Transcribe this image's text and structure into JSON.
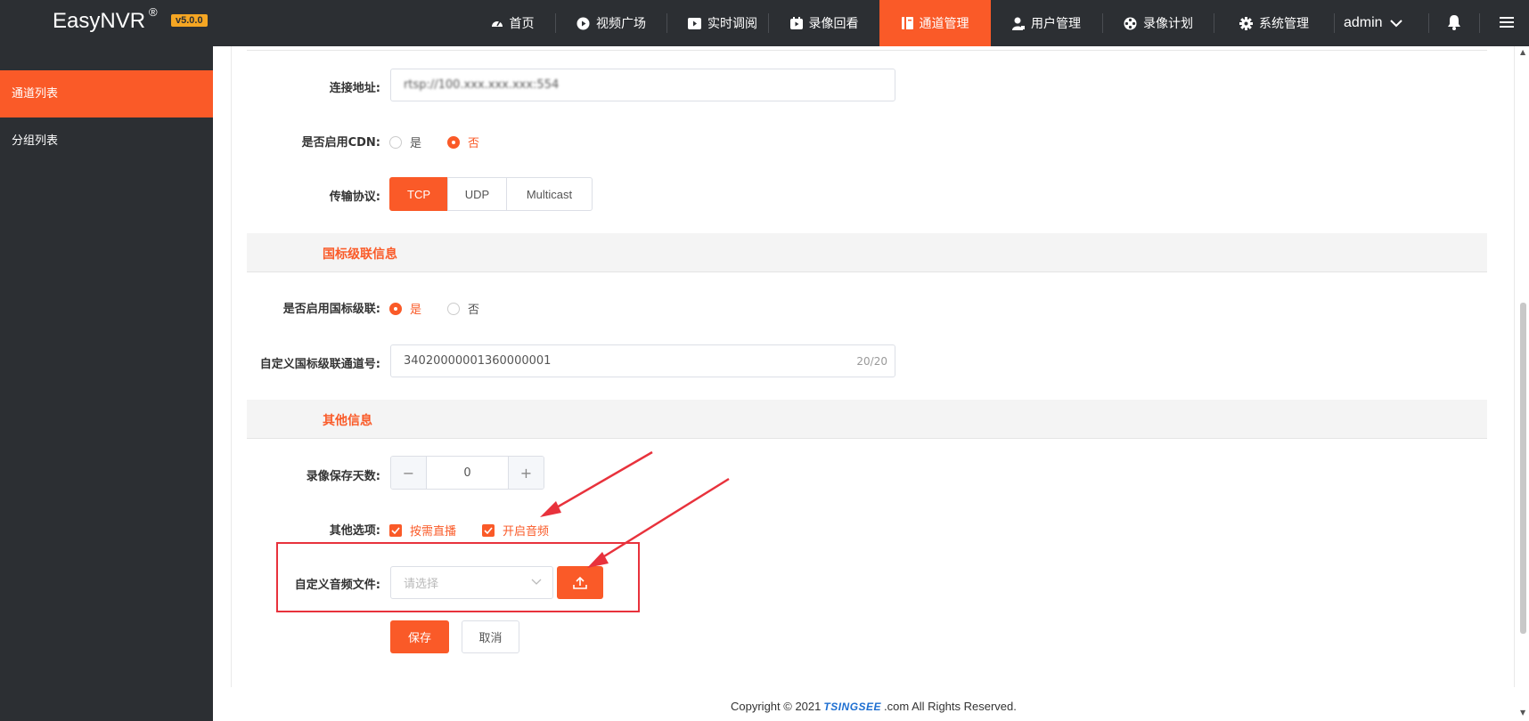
{
  "header": {
    "logo": "EasyNVR",
    "logo_mark": "®",
    "version": "v5.0.0",
    "nav": [
      {
        "label": "首页",
        "icon": "dashboard-icon"
      },
      {
        "label": "视频广场",
        "icon": "play-circle-icon"
      },
      {
        "label": "实时调阅",
        "icon": "video-icon"
      },
      {
        "label": "录像回看",
        "icon": "playback-icon"
      },
      {
        "label": "通道管理",
        "icon": "book-icon",
        "active": true
      },
      {
        "label": "用户管理",
        "icon": "user-icon"
      },
      {
        "label": "录像计划",
        "icon": "film-reel-icon"
      },
      {
        "label": "系统管理",
        "icon": "gear-icon"
      }
    ],
    "user": "admin"
  },
  "sidebar": {
    "items": [
      {
        "label": "通道列表",
        "active": true
      },
      {
        "label": "分组列表"
      }
    ]
  },
  "form": {
    "connect_label": "连接地址:",
    "connect_value": "rtsp://100.xxx.xxx.xxx:554",
    "cdn_label": "是否启用CDN:",
    "cdn_yes": "是",
    "cdn_no": "否",
    "cdn_selected": "否",
    "protocol_label": "传输协议:",
    "protocols": [
      "TCP",
      "UDP",
      "Multicast"
    ],
    "protocol_selected": "TCP",
    "gb_section": "国标级联信息",
    "gb_enable_label": "是否启用国标级联:",
    "gb_yes": "是",
    "gb_no": "否",
    "gb_selected": "是",
    "gb_channel_label": "自定义国标级联通道号:",
    "gb_channel_value": "34020000001360000001",
    "gb_channel_count": "20/20",
    "other_section": "其他信息",
    "record_days_label": "录像保存天数:",
    "record_days_value": "0",
    "minus": "−",
    "plus": "+",
    "options_label": "其他选项:",
    "option_on_demand": "按需直播",
    "option_audio": "开启音频",
    "audio_file_label": "自定义音频文件:",
    "audio_file_placeholder": "请选择",
    "save": "保存",
    "cancel": "取消"
  },
  "footer": {
    "prefix": "Copyright © 2021",
    "brand": "TSINGSEE",
    "suffix": ".com All Rights Reserved."
  },
  "colors": {
    "accent": "#fa5a28",
    "dark": "#2c2f33",
    "annotation": "#e8323c"
  }
}
